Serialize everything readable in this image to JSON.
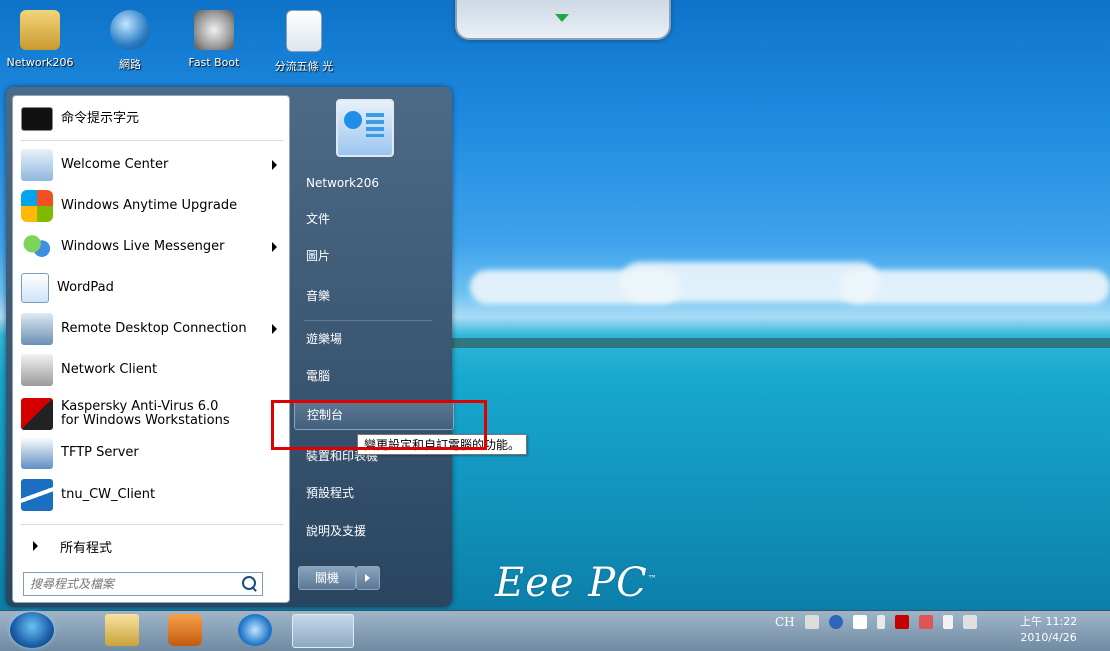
{
  "desktop": {
    "icons": [
      {
        "label": "Network206"
      },
      {
        "label": "網路"
      },
      {
        "label": "Fast Boot"
      },
      {
        "label": "分流五條 光"
      }
    ],
    "brand": "Eee PC"
  },
  "start_menu": {
    "left_items": [
      {
        "label": "命令提示字元"
      },
      {
        "label": "Welcome Center"
      },
      {
        "label": "Windows Anytime Upgrade"
      },
      {
        "label": "Windows Live Messenger"
      },
      {
        "label": "WordPad"
      },
      {
        "label": "Remote Desktop Connection"
      },
      {
        "label": "Network Client"
      },
      {
        "label": "Kaspersky Anti-Virus 6.0 for Windows Workstations"
      },
      {
        "label": "TFTP Server"
      },
      {
        "label": "tnu_CW_Client"
      }
    ],
    "all_programs": "所有程式",
    "search_placeholder": "搜尋程式及檔案",
    "right_items": [
      {
        "label": "Network206"
      },
      {
        "label": "文件"
      },
      {
        "label": "圖片"
      },
      {
        "label": "音樂"
      },
      {
        "label": "遊樂場"
      },
      {
        "label": "電腦"
      },
      {
        "label": "控制台"
      },
      {
        "label": "裝置和印表機"
      },
      {
        "label": "預設程式"
      },
      {
        "label": "說明及支援"
      }
    ],
    "shutdown_label": "關機",
    "tooltip": "變更設定和自訂電腦的功能。"
  },
  "taskbar": {
    "tray_lang": "CH",
    "time": "上午 11:22",
    "date": "2010/4/26"
  },
  "colors": {
    "highlight_box": "#e00000"
  }
}
